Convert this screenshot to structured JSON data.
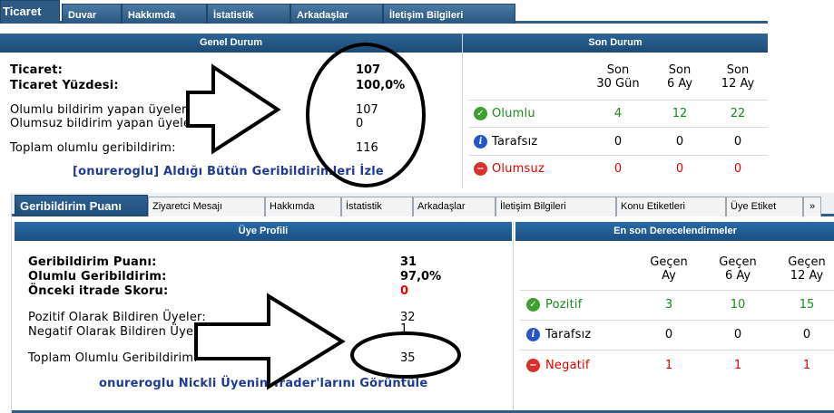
{
  "top": {
    "tabs": [
      {
        "label": "Ticaret",
        "active": true
      },
      {
        "label": "Duvar"
      },
      {
        "label": "Hakkımda"
      },
      {
        "label": "İstatistik"
      },
      {
        "label": "Arkadaşlar"
      },
      {
        "label": "İletişim Bilgileri"
      }
    ],
    "left_header": "Genel Durum",
    "right_header": "Son Durum",
    "stats": [
      {
        "label": "Ticaret:",
        "value": "107"
      },
      {
        "label": "Ticaret Yüzdesi:",
        "value": "100,0%"
      },
      {
        "label": "Olumlu bildirim yapan üyeler:",
        "value": "107"
      },
      {
        "label": "Olumsuz bildirim yapan üyeler:",
        "value": "0"
      },
      {
        "label": "Toplam olumlu geribildirim:",
        "value": "116"
      }
    ],
    "link": "[onureroglu] Aldığı Bütün Geribildirimleri İzle",
    "columns": [
      {
        "line1": "Son",
        "line2": "30 Gün"
      },
      {
        "line1": "Son",
        "line2": "6 Ay"
      },
      {
        "line1": "Son",
        "line2": "12 Ay"
      }
    ],
    "rows": [
      {
        "label": "Olumlu",
        "icon": "check-icon",
        "values": [
          "4",
          "12",
          "22"
        ]
      },
      {
        "label": "Tarafsız",
        "icon": "info-icon",
        "values": [
          "0",
          "0",
          "0"
        ]
      },
      {
        "label": "Olumsuz",
        "icon": "minus-icon",
        "values": [
          "0",
          "0",
          "0"
        ]
      }
    ]
  },
  "bottom": {
    "tabs": [
      {
        "label": "Geribildirim Puanı",
        "active": true
      },
      {
        "label": "Ziyaretci Mesajı"
      },
      {
        "label": "Hakkımda"
      },
      {
        "label": "İstatistik"
      },
      {
        "label": "Arkadaşlar"
      },
      {
        "label": "İletişim Bilgileri"
      },
      {
        "label": "Konu Etiketleri"
      },
      {
        "label": "Üye Etiket"
      },
      {
        "label": "»"
      }
    ],
    "left_header": "Üye Profili",
    "right_header": "En son Derecelendirmeler",
    "stats": [
      {
        "label": "Geribildirim Puanı:",
        "value": "31"
      },
      {
        "label": "Olumlu Geribildirim:",
        "value": "97,0%"
      },
      {
        "label": "Önceki itrade Skoru:",
        "value": "0"
      },
      {
        "label": "Pozitif Olarak Bildiren Üyeler:",
        "value": "32"
      },
      {
        "label": "Negatif Olarak Bildiren Üyeler:",
        "value": "1"
      },
      {
        "label": "Toplam Olumlu Geribildirim:",
        "value": "35"
      }
    ],
    "link": "onureroglu Nickli Üyenin Trader'larını Görüntüle",
    "columns": [
      {
        "line1": "Geçen",
        "line2": "Ay"
      },
      {
        "line1": "Geçen",
        "line2": "6 Ay"
      },
      {
        "line1": "Geçen",
        "line2": "12 Ay"
      }
    ],
    "rows": [
      {
        "label": "Pozitif",
        "icon": "check-icon",
        "values": [
          "3",
          "10",
          "15"
        ]
      },
      {
        "label": "Tarafsız",
        "icon": "info-icon",
        "values": [
          "0",
          "0",
          "0"
        ]
      },
      {
        "label": "Negatif",
        "icon": "minus-icon",
        "values": [
          "1",
          "1",
          "1"
        ]
      }
    ]
  },
  "colors": {
    "tab_blue": "#2c5a83",
    "header_blue": "#1d4a74",
    "positive_green": "#1a8a1a",
    "negative_red": "#e00000",
    "link_blue": "#1f3a96"
  }
}
